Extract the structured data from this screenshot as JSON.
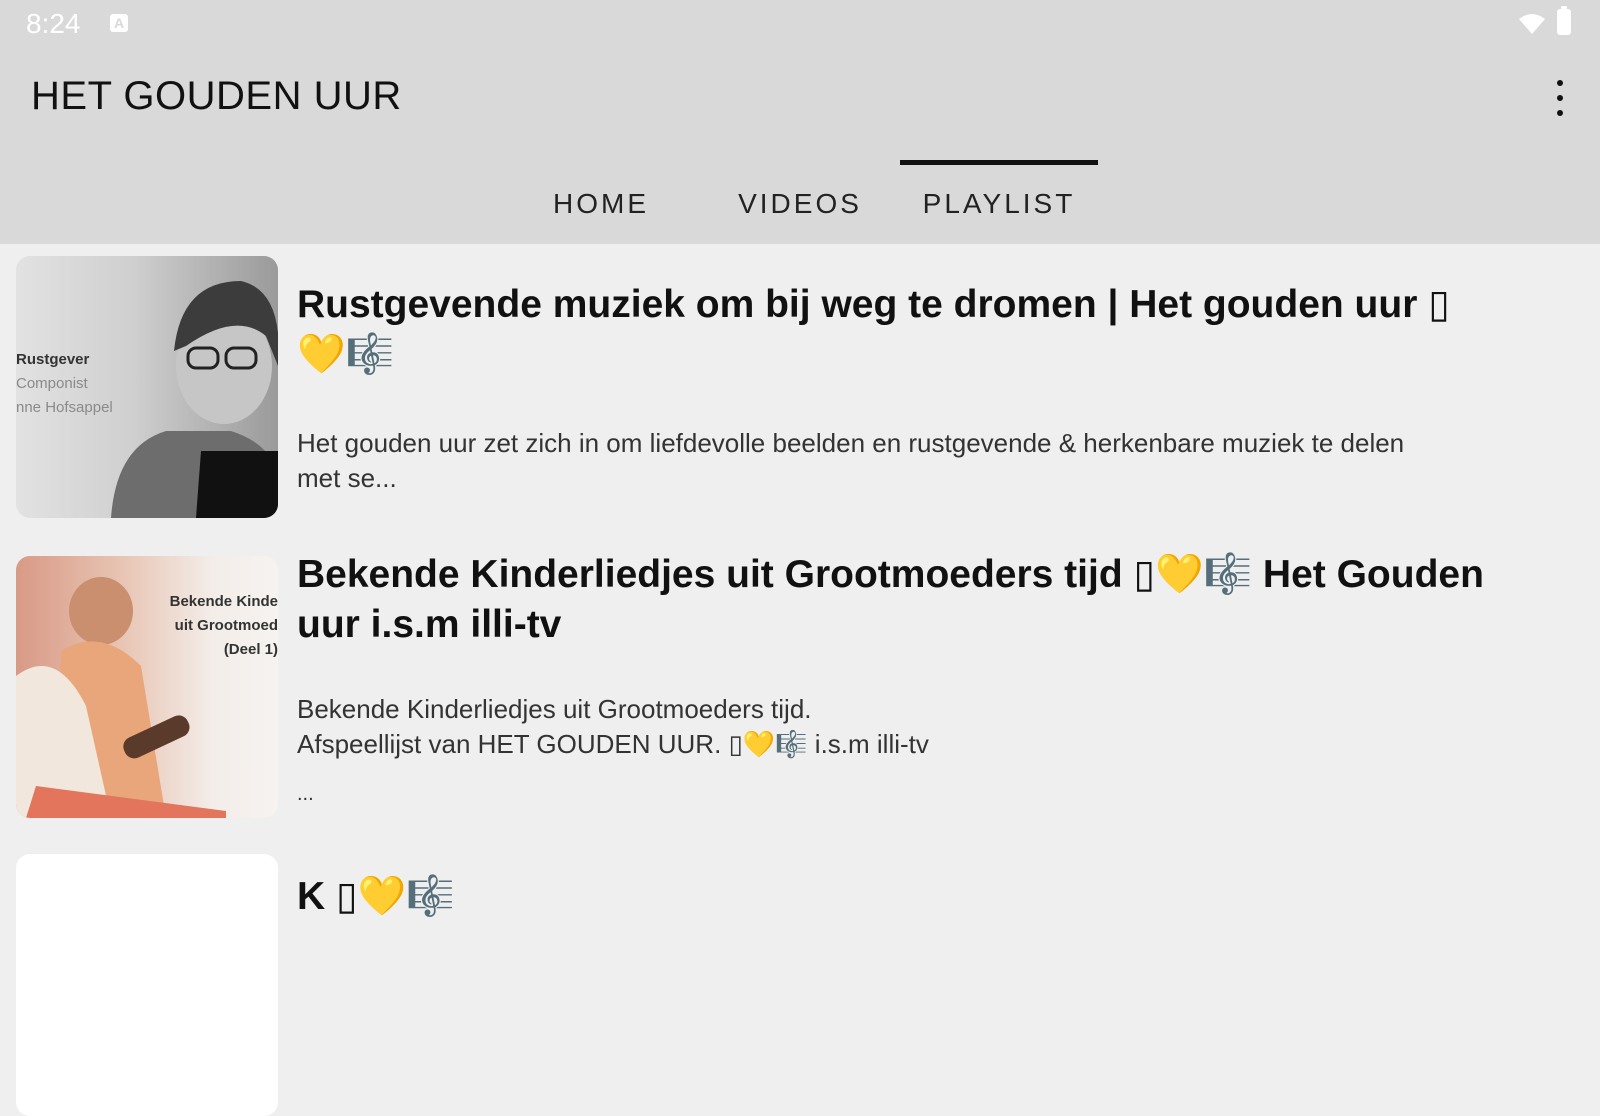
{
  "status_bar": {
    "time": "8:24",
    "notification_icon": "a-icon",
    "wifi_icon": "wifi-icon",
    "battery_icon": "battery-icon"
  },
  "app_bar": {
    "title": "HET GOUDEN UUR",
    "menu_icon": "more-vert-icon"
  },
  "tabs": [
    {
      "label": "HOME",
      "selected": false
    },
    {
      "label": "VIDEOS",
      "selected": false
    },
    {
      "label": "PLAYLIST",
      "selected": true
    }
  ],
  "playlists": [
    {
      "title_line1": "Rustgevende muziek om bij weg te dromen | Het gouden uur  ▯",
      "title_line2": "💛🎼",
      "desc_line1": "Het gouden uur zet zich in om liefdevolle beelden en rustgevende & herkenbare muziek te delen",
      "desc_line2": "met se...",
      "thumb_lines": [
        "Rustgever",
        "Componist",
        "nne Hofsappel"
      ]
    },
    {
      "title_line1": "Bekende Kinderliedjes uit Grootmoeders tijd ▯💛🎼 Het Gouden",
      "title_line2": "uur i.s.m illi-tv",
      "desc_line1": "Bekende Kinderliedjes uit Grootmoeders tijd.",
      "desc_line2": "Afspeellijst van HET GOUDEN UUR. ▯💛🎼 i.s.m illi-tv",
      "desc_line3": "...",
      "thumb_lines": [
        "Bekende Kinde",
        "uit Grootmoed",
        "(Deel 1)"
      ]
    },
    {
      "title_line1": "K          ▯💛🎼"
    }
  ],
  "colors": {
    "app_bar": "#d9d9d9",
    "background": "#efefef",
    "text": "#111111",
    "accent": "#111111"
  }
}
